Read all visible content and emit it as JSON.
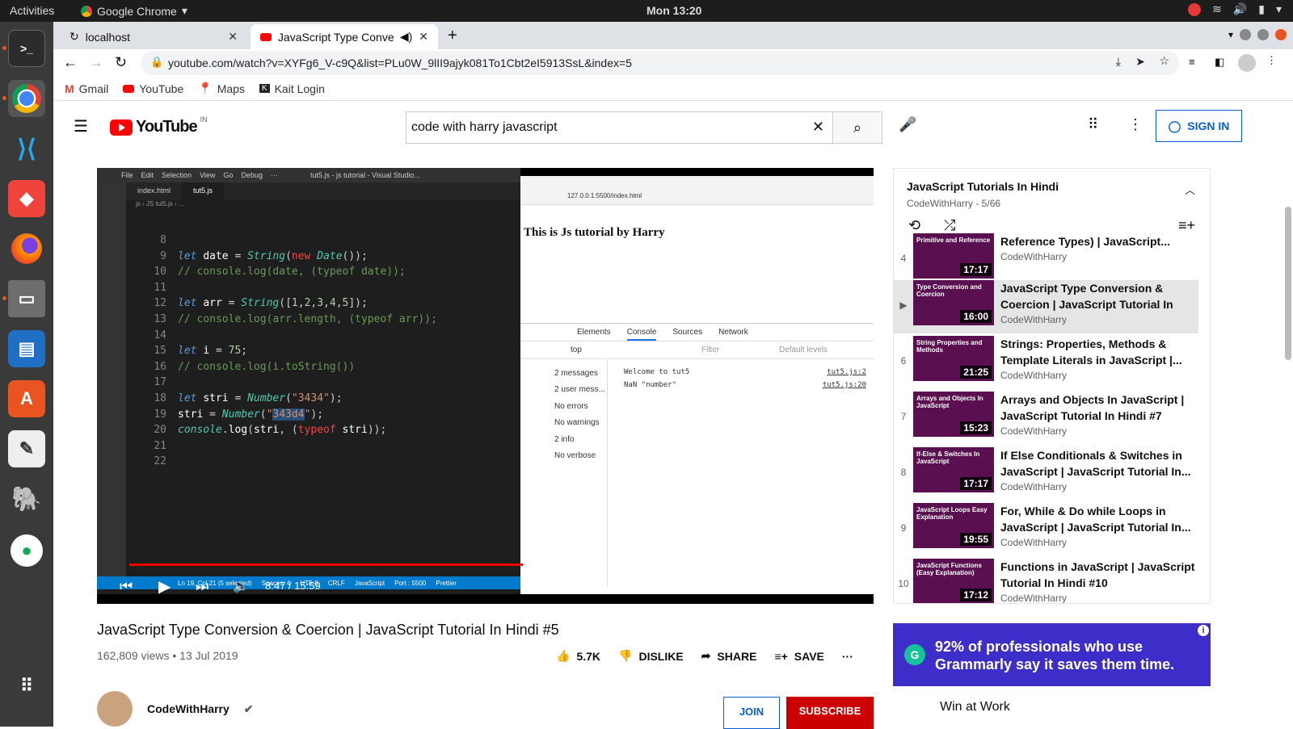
{
  "os": {
    "activities": "Activities",
    "app_name": "Google Chrome",
    "clock": "Mon 13:20"
  },
  "chrome": {
    "tabs": [
      {
        "label": "localhost"
      },
      {
        "label": "JavaScript Type Conve"
      }
    ],
    "url": "youtube.com/watch?v=XYFg6_V-c9Q&list=PLu0W_9lII9ajyk081To1Cbt2eI5913SsL&index=5",
    "bookmarks": [
      "Gmail",
      "YouTube",
      "Maps",
      "Kait Login"
    ]
  },
  "youtube": {
    "logo_text": "YouTube",
    "country": "IN",
    "search_value": "code with harry javascript",
    "sign_in": "SIGN IN",
    "video": {
      "title": "JavaScript Type Conversion & Coercion | JavaScript Tutorial In Hindi #5",
      "views": "162,809 views • 13 Jul 2019",
      "likes": "5.7K",
      "dislike": "DISLIKE",
      "share": "SHARE",
      "save": "SAVE",
      "time": "8:47 / 15:59",
      "progress": 0.553
    },
    "channel": {
      "name": "CodeWithHarry",
      "join": "JOIN",
      "subscribe": "SUBSCRIBE"
    },
    "playlist": {
      "title": "JavaScript Tutorials In Hindi",
      "subtitle": "CodeWithHarry - 5/66",
      "items": [
        {
          "idx": "4",
          "title": "Reference Types) | JavaScript...",
          "channel": "CodeWithHarry",
          "duration": "17:17",
          "thumb": "Primitive and Reference"
        },
        {
          "idx": "▶",
          "title": "JavaScript Type Conversion & Coercion | JavaScript Tutorial In Hin...",
          "channel": "CodeWithHarry",
          "duration": "16:00",
          "thumb": "Type Conversion and Coercion"
        },
        {
          "idx": "6",
          "title": "Strings: Properties, Methods & Template Literals in JavaScript |...",
          "channel": "CodeWithHarry",
          "duration": "21:25",
          "thumb": "String Properties and Methods"
        },
        {
          "idx": "7",
          "title": "Arrays and Objects In JavaScript | JavaScript Tutorial In Hindi #7",
          "channel": "CodeWithHarry",
          "duration": "15:23",
          "thumb": "Arrays and Objects In JavaScript"
        },
        {
          "idx": "8",
          "title": "If Else Conditionals & Switches in JavaScript | JavaScript Tutorial In...",
          "channel": "CodeWithHarry",
          "duration": "17:17",
          "thumb": "If-Else & Switches In JavaScript"
        },
        {
          "idx": "9",
          "title": "For, While & Do while Loops in JavaScript | JavaScript Tutorial In...",
          "channel": "CodeWithHarry",
          "duration": "19:55",
          "thumb": "JavaScript Loops Easy Explanation"
        },
        {
          "idx": "10",
          "title": "Functions in JavaScript | JavaScript Tutorial In Hindi #10",
          "channel": "CodeWithHarry",
          "duration": "17:12",
          "thumb": "JavaScript Functions (Easy Explanation)"
        }
      ]
    },
    "ad": {
      "text": "92% of professionals who use Grammarly say it saves them time.",
      "next": "Win at Work"
    }
  },
  "in_video": {
    "vscode": {
      "menu": [
        "File",
        "Edit",
        "Selection",
        "View",
        "Go",
        "Debug",
        "···"
      ],
      "window_title": "tut5.js - js tutorial - Visual Studio...",
      "tabs": [
        "index.html",
        "tut5.js"
      ],
      "breadcrumb": "js › JS tut5.js › ...",
      "status": [
        "Ln 19, Col 21 (5 selected)",
        "Spaces: 4",
        "UTF-8",
        "CRLF",
        "JavaScript",
        "Port : 5500",
        "Prettier"
      ]
    },
    "page_heading": "This is Js tutorial by Harry",
    "address": "127.0.0.1:5500/index.html",
    "devtools": {
      "tabs": [
        "Elements",
        "Console",
        "Sources",
        "Network"
      ],
      "context": "top",
      "filter": "Filter",
      "levels": "Default levels",
      "sidebar": [
        "2 messages",
        "2 user mess...",
        "No errors",
        "No warnings",
        "2 info",
        "No verbose"
      ],
      "logs": [
        {
          "text": "Welcome to tut5",
          "src": "tut5.js:2"
        },
        {
          "text": "NaN \"number\"",
          "src": "tut5.js:20"
        }
      ]
    }
  }
}
